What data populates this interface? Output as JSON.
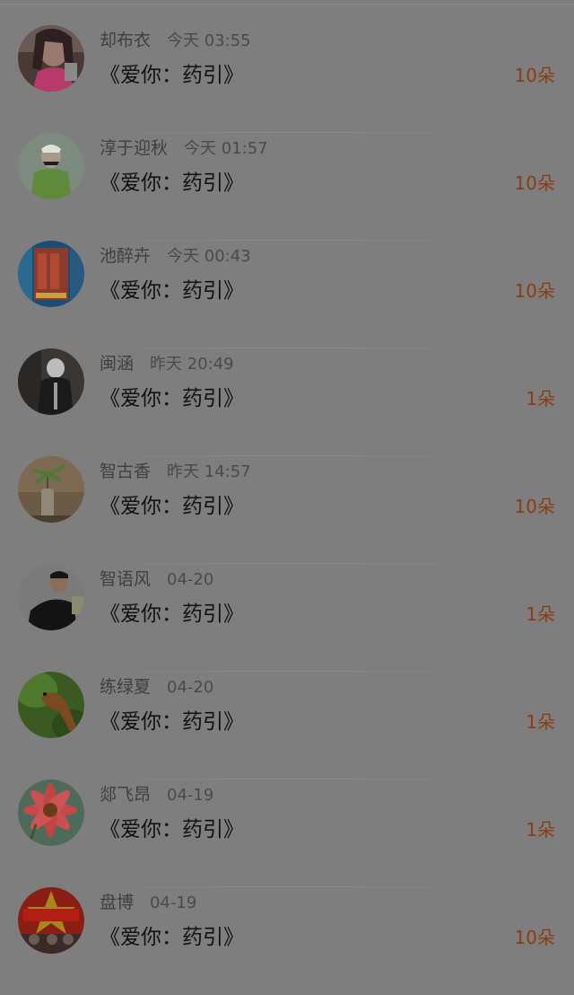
{
  "items": [
    {
      "name": "却布衣",
      "time": "今天 03:55",
      "book": "《爱你：药引》",
      "count": "10朵",
      "avatar": "photo-avatar-woman-pink"
    },
    {
      "name": "淳于迎秋",
      "time": "今天 01:57",
      "book": "《爱你：药引》",
      "count": "10朵",
      "avatar": "photo-avatar-green-figure"
    },
    {
      "name": "池醉卉",
      "time": "今天 00:43",
      "book": "《爱你：药引》",
      "count": "10朵",
      "avatar": "photo-avatar-blue-red"
    },
    {
      "name": "闽涵",
      "time": "昨天 20:49",
      "book": "《爱你：药引》",
      "count": "1朵",
      "avatar": "photo-avatar-dark-figure"
    },
    {
      "name": "智古香",
      "time": "昨天 14:57",
      "book": "《爱你：药引》",
      "count": "10朵",
      "avatar": "photo-avatar-plant-vase"
    },
    {
      "name": "智语风",
      "time": "04-20",
      "book": "《爱你：药引》",
      "count": "1朵",
      "avatar": "photo-avatar-man-black"
    },
    {
      "name": "练绿夏",
      "time": "04-20",
      "book": "《爱你：药引》",
      "count": "1朵",
      "avatar": "photo-avatar-bird"
    },
    {
      "name": "郯飞昂",
      "time": "04-19",
      "book": "《爱你：药引》",
      "count": "1朵",
      "avatar": "photo-avatar-pink-flower"
    },
    {
      "name": "盘博",
      "time": "04-19",
      "book": "《爱你：药引》",
      "count": "10朵",
      "avatar": "photo-avatar-red-poster"
    }
  ]
}
